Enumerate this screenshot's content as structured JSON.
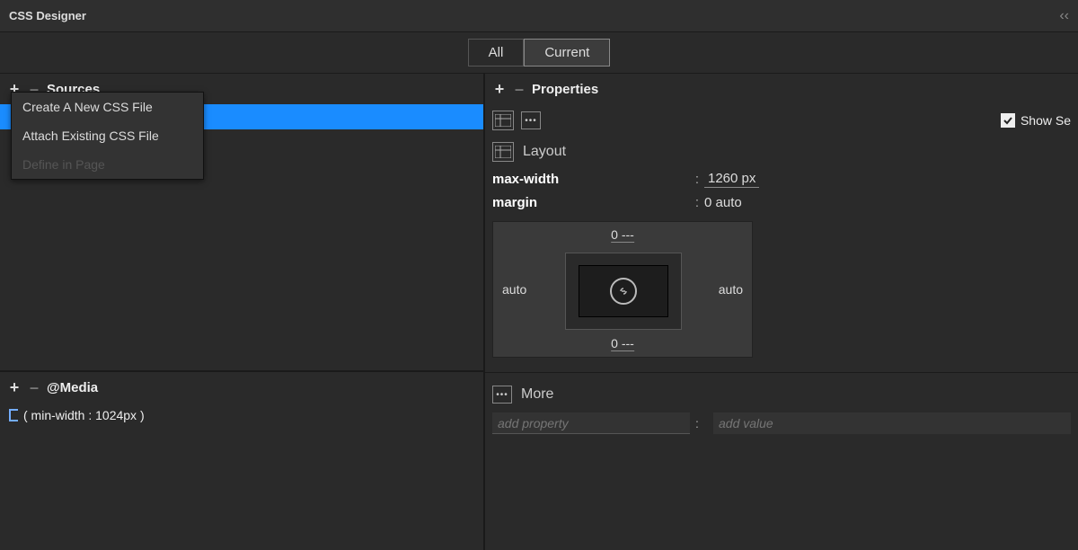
{
  "title": "CSS Designer",
  "tabs": {
    "all": "All",
    "current": "Current"
  },
  "sources": {
    "header": "Sources",
    "menu": {
      "create": "Create A New CSS File",
      "attach": "Attach Existing CSS File",
      "define": "Define in Page"
    }
  },
  "media": {
    "header": "@Media",
    "rule": "( min-width : 1024px )"
  },
  "properties": {
    "header": "Properties",
    "show_set": "Show Se",
    "layout_label": "Layout",
    "max_width_label": "max-width",
    "max_width_value": "1260 px",
    "margin_label": "margin",
    "margin_value": "0 auto",
    "margin_box": {
      "top": "0 ---",
      "bottom": "0 ---",
      "left": "auto",
      "right": "auto"
    },
    "more_label": "More",
    "add_prop_placeholder": "add property",
    "add_val_placeholder": "add value"
  }
}
